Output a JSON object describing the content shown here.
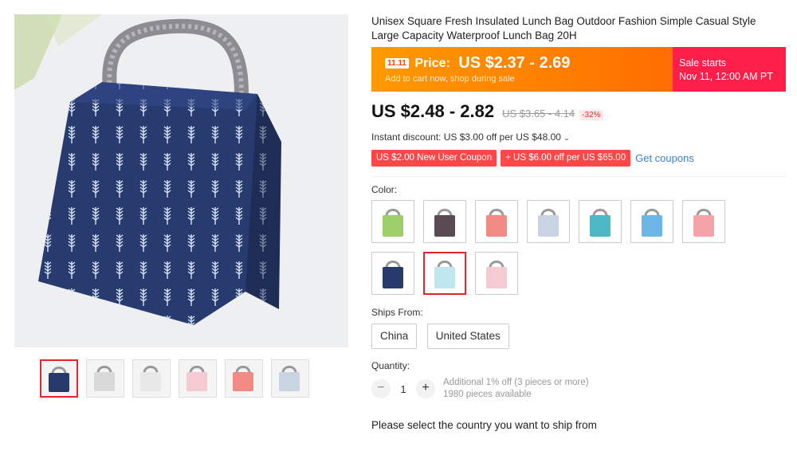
{
  "product": {
    "title": "Unisex Square Fresh Insulated Lunch Bag Outdoor Fashion Simple Casual Style Large Capacity Waterproof Lunch Bag 20H"
  },
  "promo": {
    "badge": "11.11",
    "price_label": "Price:",
    "price": "US $2.37 - 2.69",
    "subtitle": "Add to cart now, shop during sale",
    "sale_line1": "Sale starts",
    "sale_line2": "Nov 11, 12:00 AM PT"
  },
  "pricing": {
    "price": "US $2.48 - 2.82",
    "original": "US $3.65 - 4.14",
    "discount": "-32%"
  },
  "instant_discount": "Instant discount: US $3.00 off per US $48.00",
  "coupons": {
    "new_user": "US $2.00 New User Coupon",
    "store": "+ US $6.00 off per US $65.00",
    "get": "Get coupons"
  },
  "color": {
    "label": "Color:",
    "swatches": [
      {
        "name": "green",
        "color": "#9ccf6a"
      },
      {
        "name": "dark-floral",
        "color": "#5a4b52"
      },
      {
        "name": "coral",
        "color": "#f28a84"
      },
      {
        "name": "white-pattern",
        "color": "#c9d3e2"
      },
      {
        "name": "teal-leaf",
        "color": "#4bb8c4"
      },
      {
        "name": "blue",
        "color": "#6cb6e6"
      },
      {
        "name": "pink",
        "color": "#f4a4a8"
      },
      {
        "name": "navy",
        "color": "#263a6b"
      },
      {
        "name": "light-blue",
        "color": "#bde6ee"
      },
      {
        "name": "light-pink",
        "color": "#f5cad3"
      }
    ],
    "selected_index": 8
  },
  "ships_from": {
    "label": "Ships From:",
    "options": [
      "China",
      "United States"
    ]
  },
  "quantity": {
    "label": "Quantity:",
    "minus": "−",
    "plus": "+",
    "value": "1",
    "note1": "Additional 1% off (3 pieces or more)",
    "note2": "1980 pieces available"
  },
  "ship_notice": "Please select the country you want to ship from",
  "thumbnails": [
    {
      "name": "navy",
      "color": "#263a6b"
    },
    {
      "name": "interior",
      "color": "#d9d9d9"
    },
    {
      "name": "all-colors",
      "color": "#e8e8e8"
    },
    {
      "name": "light-pink",
      "color": "#f5cad3"
    },
    {
      "name": "coral",
      "color": "#f28a84"
    },
    {
      "name": "white-pattern",
      "color": "#c9d3e2"
    }
  ]
}
